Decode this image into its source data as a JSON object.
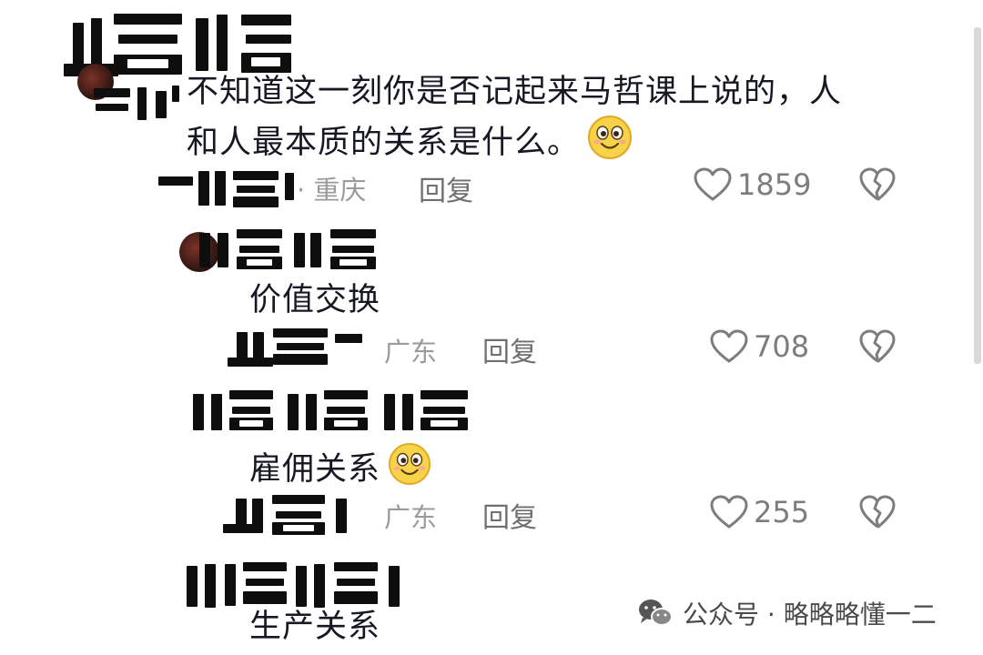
{
  "comments": [
    {
      "text_lines": [
        "不知道这一刻你是否记起来马哲课上说的，人",
        "和人最本质的关系是什么。"
      ],
      "location": "· 重庆",
      "reply_label": "回复",
      "likes": "1859",
      "emoji": "smile-emoji"
    },
    {
      "text": "价值交换",
      "location": "广东",
      "reply_label": "回复",
      "likes": "708"
    },
    {
      "text": "雇佣关系",
      "location": "广东",
      "reply_label": "回复",
      "likes": "255",
      "emoji": "smile-emoji"
    },
    {
      "text": "生产关系"
    }
  ],
  "watermark": {
    "source": "公众号 · 略略略懂一二",
    "icon": "wechat-icon"
  },
  "colors": {
    "text": "#161823",
    "meta": "#9b9b9b",
    "icon": "#7d7d7d"
  }
}
